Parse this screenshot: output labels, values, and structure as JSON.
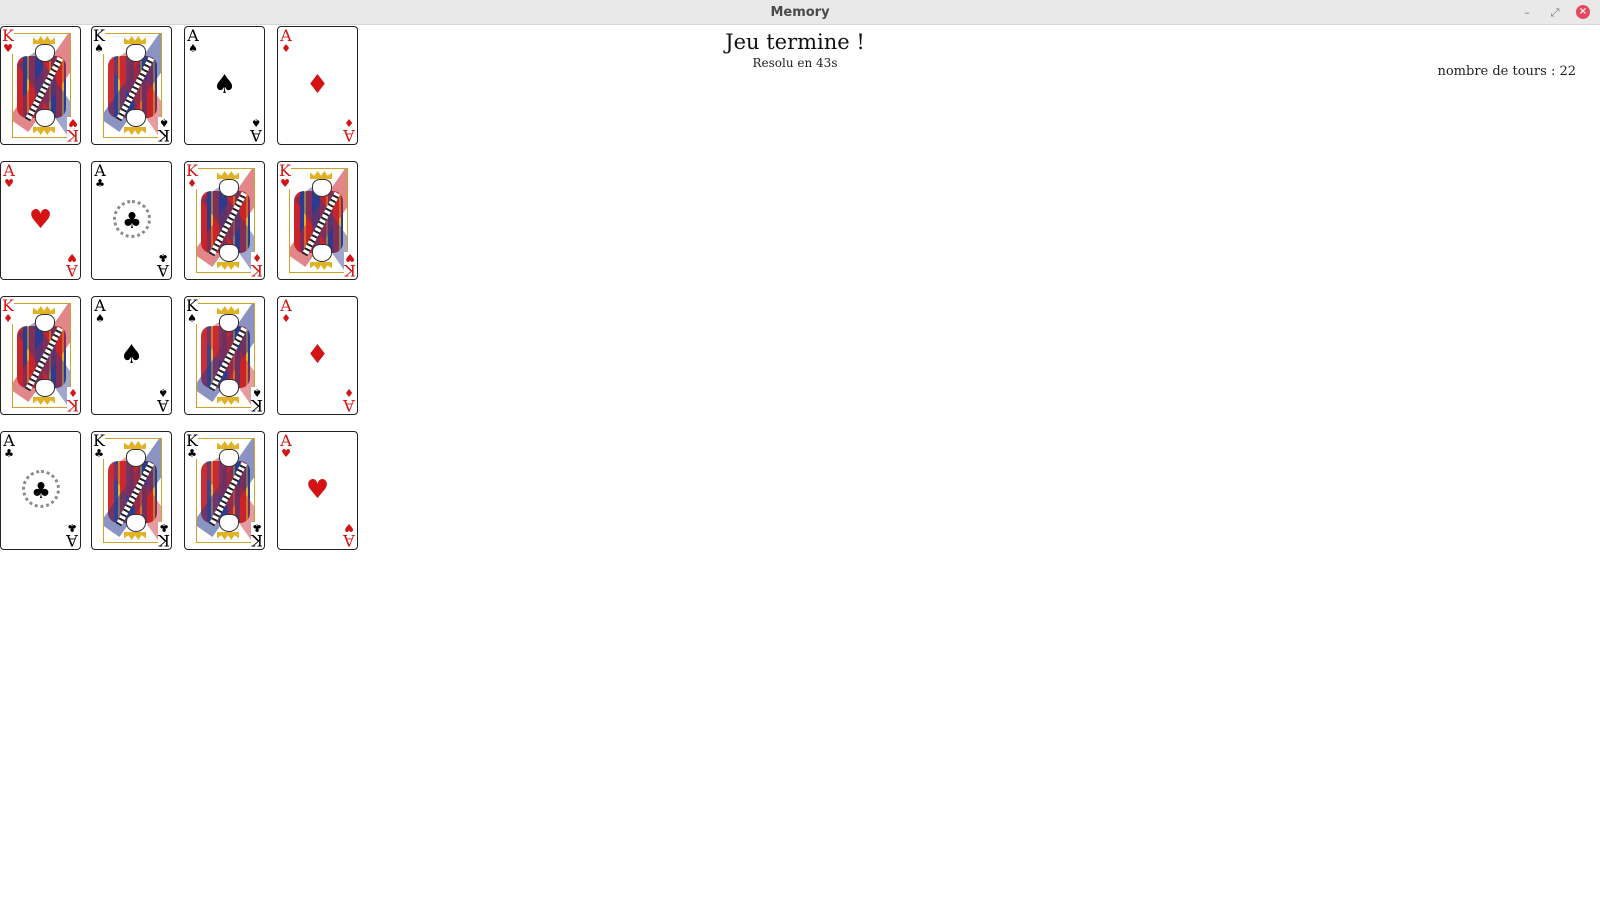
{
  "window": {
    "title": "Memory",
    "controls": {
      "minimize": "–",
      "maximize": "⤢",
      "close": "×"
    }
  },
  "status": {
    "title": "Jeu termine !",
    "subtitle": "Resolu en 43s",
    "turns": "nombre de tours : 22"
  },
  "colors": {
    "red": "#d41414",
    "black": "#000000",
    "robe_red": "#c8242a",
    "robe_blue": "#2c3b8f",
    "gold": "#e0b224"
  },
  "cards": [
    {
      "rank": "K",
      "suit": "♥",
      "color": "red",
      "face": true
    },
    {
      "rank": "K",
      "suit": "♠",
      "color": "black",
      "face": true
    },
    {
      "rank": "A",
      "suit": "♠",
      "color": "black",
      "face": false
    },
    {
      "rank": "A",
      "suit": "♦",
      "color": "red",
      "face": false
    },
    {
      "rank": "A",
      "suit": "♥",
      "color": "red",
      "face": false
    },
    {
      "rank": "A",
      "suit": "♣",
      "color": "black",
      "face": false
    },
    {
      "rank": "K",
      "suit": "♦",
      "color": "red",
      "face": true
    },
    {
      "rank": "K",
      "suit": "♥",
      "color": "red",
      "face": true
    },
    {
      "rank": "K",
      "suit": "♦",
      "color": "red",
      "face": true
    },
    {
      "rank": "A",
      "suit": "♠",
      "color": "black",
      "face": false
    },
    {
      "rank": "K",
      "suit": "♠",
      "color": "black",
      "face": true
    },
    {
      "rank": "A",
      "suit": "♦",
      "color": "red",
      "face": false
    },
    {
      "rank": "A",
      "suit": "♣",
      "color": "black",
      "face": false
    },
    {
      "rank": "K",
      "suit": "♣",
      "color": "black",
      "face": true
    },
    {
      "rank": "K",
      "suit": "♣",
      "color": "black",
      "face": true
    },
    {
      "rank": "A",
      "suit": "♥",
      "color": "red",
      "face": false
    }
  ]
}
